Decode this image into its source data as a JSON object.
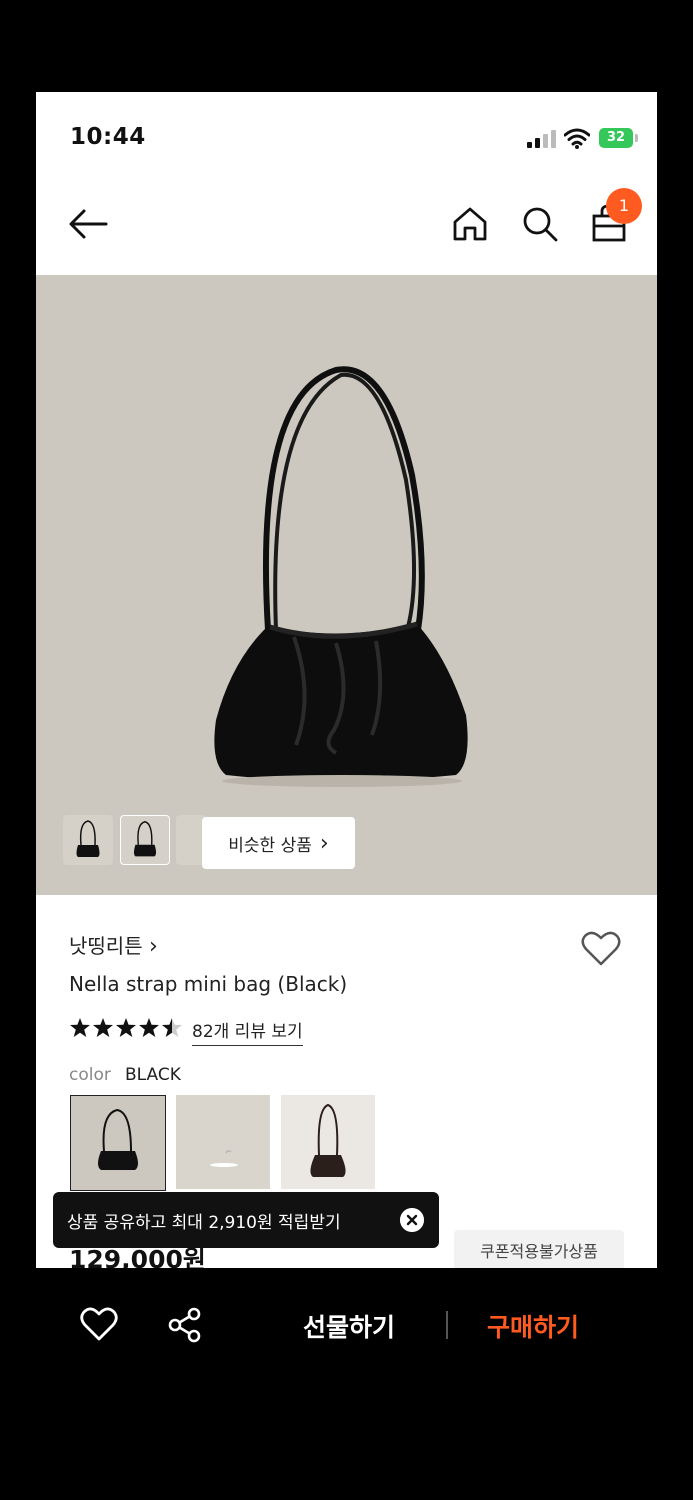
{
  "status_bar": {
    "time": "10:44",
    "battery": "32"
  },
  "nav": {
    "cart_count": "1"
  },
  "hero": {
    "similar_button": "비슷한 상품",
    "similar_arrow": "›"
  },
  "product": {
    "brand": "낫띵리튼",
    "brand_arrow": "›",
    "name": "Nella strap mini bag (Black)",
    "rating": 4.5,
    "reviews_link": "82개 리뷰 보기",
    "color_label": "color",
    "color_value": "BLACK",
    "price": "129,000원",
    "coupon_note": "쿠폰적용불가상품"
  },
  "toast": {
    "message": "상품 공유하고 최대 2,910원 적립받기"
  },
  "bottom_bar": {
    "gift_label": "선물하기",
    "buy_label": "구매하기"
  },
  "colors": {
    "accent": "#ff5a1f",
    "hero_bg": "#cdc8bf",
    "battery": "#34c759"
  }
}
